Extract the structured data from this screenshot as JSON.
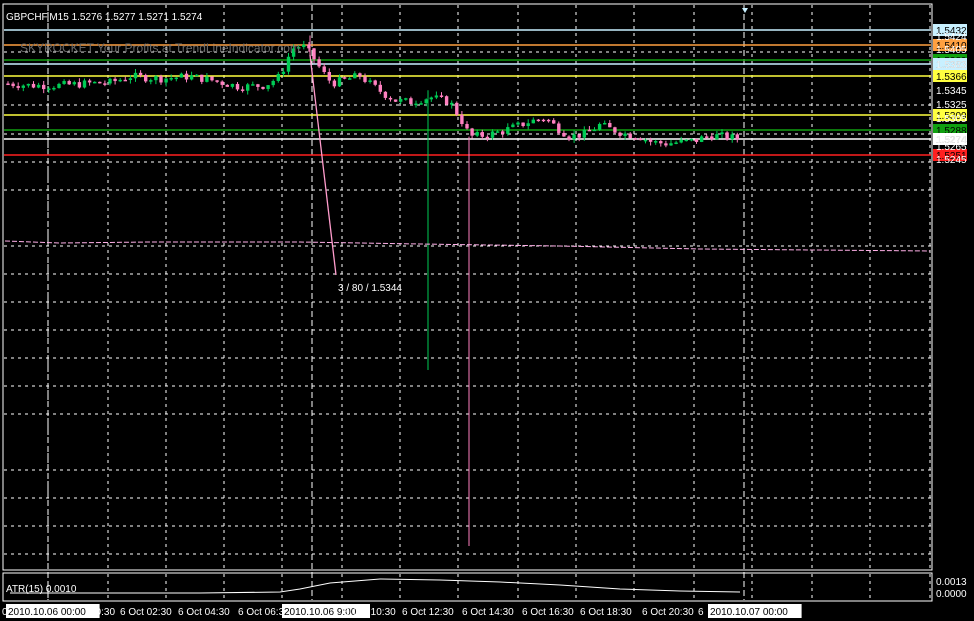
{
  "header": {
    "symbol_info": "GBPCHF,M15  1.5276 1.5277 1.5271 1.5274",
    "watermark": "SKYROCKET Your Profits at TrendLineIndicator.com"
  },
  "annotation": "3 / 80 / 1.5344",
  "indicator": {
    "label": "ATR(15) 0.0010",
    "scale_top": "0.0013",
    "scale_bottom": "0.0000"
  },
  "price_scale": [
    "1.5424",
    "1.5405",
    "1.5383",
    "1.5345",
    "1.5325",
    "1.5305",
    "1.5274",
    "1.5265",
    "1.5245"
  ],
  "levels": [
    {
      "price": "1.5432",
      "color": "#c8f0ff",
      "text": "#000000"
    },
    {
      "price": "1.5410",
      "color": "#ffa040",
      "text": "#000000"
    },
    {
      "price": "1.5389",
      "color": "#10a010",
      "text": "#000000"
    },
    {
      "price": "1.5383",
      "color": "#c8f0ff",
      "text": "#000000"
    },
    {
      "price": "1.5366",
      "color": "#ffff40",
      "text": "#000000"
    },
    {
      "price": "1.5309",
      "color": "#ffff40",
      "text": "#000000"
    },
    {
      "price": "1.5288",
      "color": "#10a010",
      "text": "#000000"
    },
    {
      "price": "1.5274",
      "color": "#ffffff",
      "text": "#000000"
    },
    {
      "price": "1.5251",
      "color": "#ff2020",
      "text": "#000000"
    }
  ],
  "time_axis": [
    {
      "label": "0.1",
      "highlight": false
    },
    {
      "label": "2010.10.06 00:00",
      "highlight": true
    },
    {
      "label": "00:30",
      "highlight": false
    },
    {
      "label": "6 Oct 02:30",
      "highlight": false
    },
    {
      "label": "6 Oct 04:30",
      "highlight": false
    },
    {
      "label": "6 Oct 06:30",
      "highlight": false
    },
    {
      "label": "2010.10.06 9:00",
      "highlight": true
    },
    {
      "label": "6 Oct 10:30",
      "highlight": false
    },
    {
      "label": "6 Oct 12:30",
      "highlight": false
    },
    {
      "label": "6 Oct 14:30",
      "highlight": false
    },
    {
      "label": "6 Oct 16:30",
      "highlight": false
    },
    {
      "label": "6 Oct 18:30",
      "highlight": false
    },
    {
      "label": "6 Oct 20:30",
      "highlight": false
    },
    {
      "label": "6",
      "highlight": false
    },
    {
      "label": "2010.10.07 00:00",
      "highlight": true
    }
  ],
  "colors": {
    "background": "#000000",
    "grid": "#ffffff",
    "bull_candle": "#00cc55",
    "bear_candle": "#ff80c0",
    "atr_line": "#ffffff",
    "avg_line": "#ffb0e8"
  }
}
